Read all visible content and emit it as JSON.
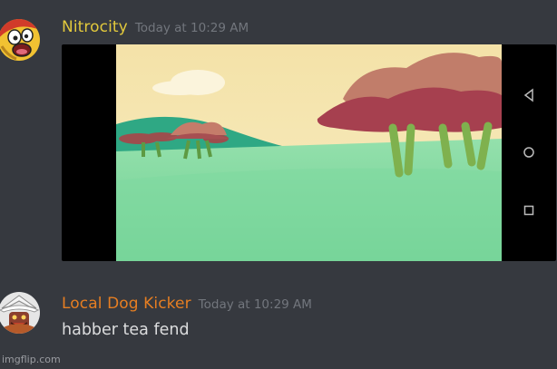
{
  "messages": [
    {
      "username": "Nitrocity",
      "timestamp": "Today at 10:29 AM",
      "username_color": "#e2c93c",
      "avatar_icon": "screaming-face-avatar"
    },
    {
      "username": "Local Dog Kicker",
      "timestamp": "Today at 10:29 AM",
      "username_color": "#e67e22",
      "content": "habber tea fend",
      "avatar_icon": "cowboy-hat-character-avatar"
    }
  ],
  "nav_buttons": [
    "back-icon",
    "home-icon",
    "recents-icon"
  ],
  "watermark": "imgflip.com",
  "colors": {
    "background": "#36393f",
    "timestamp": "#72767d",
    "text": "#dcddde"
  }
}
